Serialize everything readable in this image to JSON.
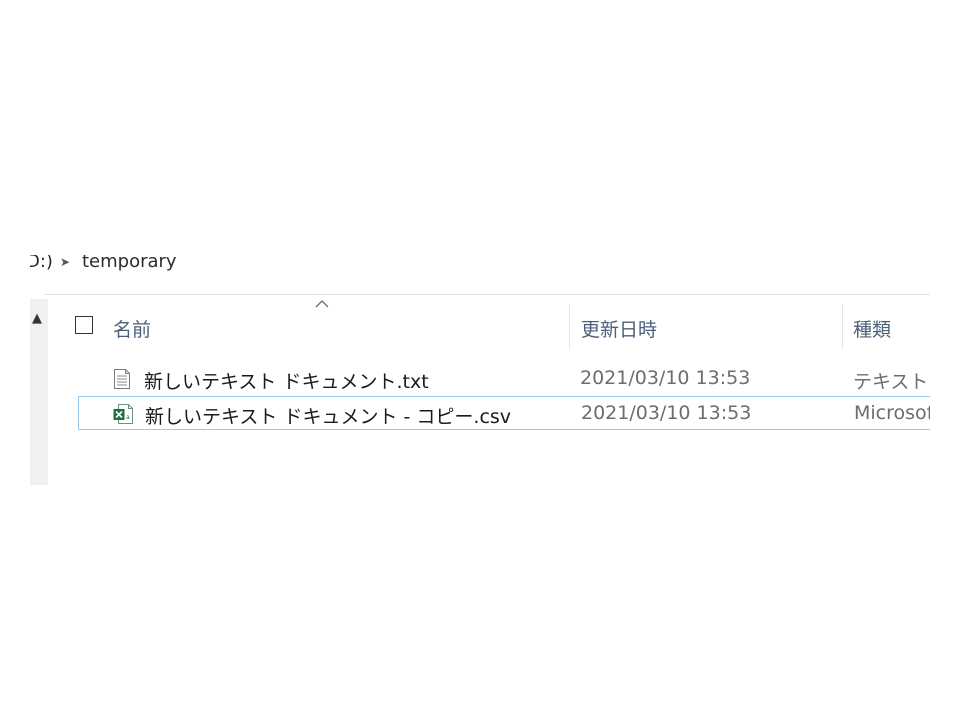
{
  "breadcrumb": {
    "prev_fragment": "D:)",
    "current": "temporary"
  },
  "columns": {
    "name": "名前",
    "date_modified": "更新日時",
    "type": "種類"
  },
  "files": [
    {
      "name": "新しいテキスト ドキュメント.txt",
      "date": "2021/03/10 13:53",
      "type": "テキスト ド",
      "icon": "text-file-icon"
    },
    {
      "name": "新しいテキスト ドキュメント - コピー.csv",
      "date": "2021/03/10 13:53",
      "type": "Microsoft",
      "icon": "excel-csv-icon"
    }
  ],
  "colors": {
    "selection_border": "#99c9ef",
    "header_text": "#4c607a",
    "excel_green": "#1d7044"
  }
}
